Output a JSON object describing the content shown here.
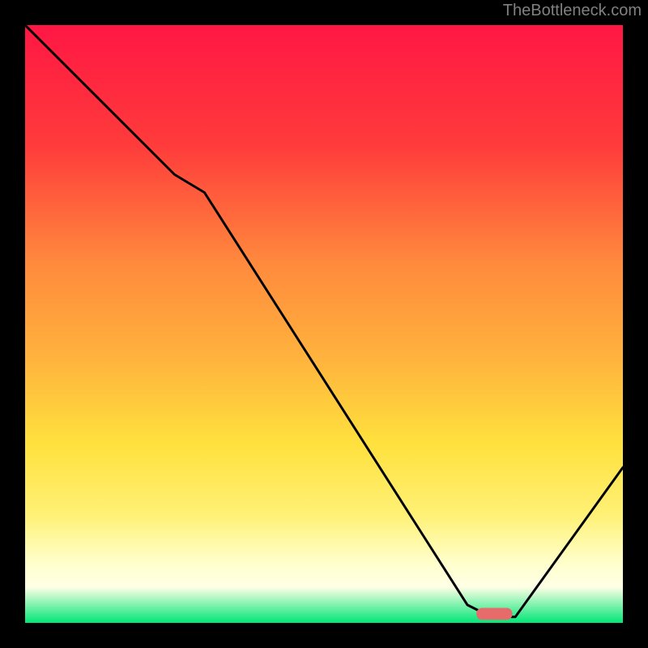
{
  "watermark": "TheBottleneck.com",
  "chart_data": {
    "type": "line",
    "title": "",
    "xlabel": "",
    "ylabel": "",
    "xlim": [
      0,
      100
    ],
    "ylim": [
      0,
      100
    ],
    "x": [
      0,
      25,
      30,
      74,
      78,
      82,
      100
    ],
    "values": [
      100,
      75,
      72,
      3,
      1,
      1,
      26
    ],
    "marker": {
      "x": 78.5,
      "y": 1.5,
      "width": 6,
      "height": 2,
      "color": "#e86b6b"
    },
    "gradient_stops": [
      {
        "offset": 0,
        "color": "#ff1744"
      },
      {
        "offset": 20,
        "color": "#ff3b3b"
      },
      {
        "offset": 40,
        "color": "#ff8a3d"
      },
      {
        "offset": 55,
        "color": "#ffb13d"
      },
      {
        "offset": 70,
        "color": "#ffe13d"
      },
      {
        "offset": 82,
        "color": "#fff176"
      },
      {
        "offset": 90,
        "color": "#ffffcc"
      },
      {
        "offset": 94,
        "color": "#ffffe6"
      },
      {
        "offset": 100,
        "color": "#00e676"
      }
    ]
  }
}
